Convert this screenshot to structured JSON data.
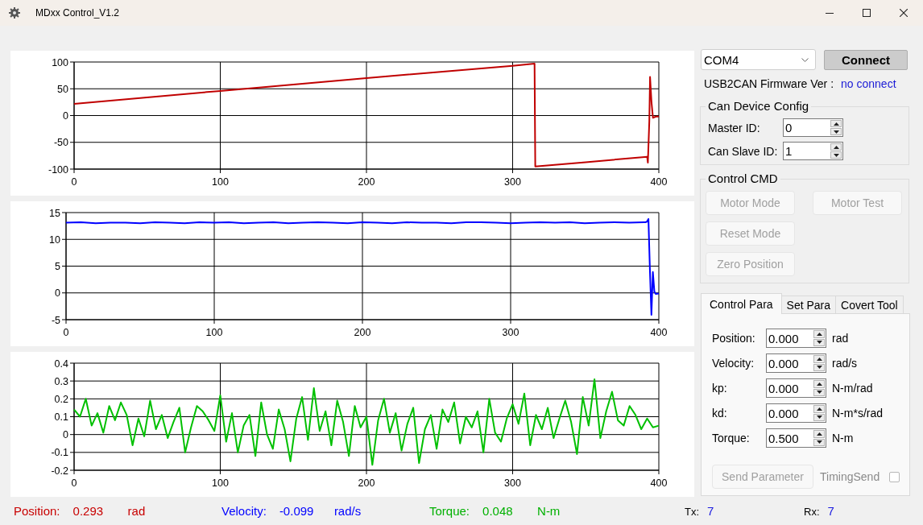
{
  "window": {
    "title": "MDxx Control_V1.2"
  },
  "charts": [
    {
      "chart_data": {
        "type": "line",
        "grid": true,
        "xlim": [
          0,
          400
        ],
        "ylim": [
          -100,
          100
        ],
        "xticks": [
          0,
          100,
          200,
          300,
          400
        ],
        "yticks": [
          100,
          50,
          0,
          -50,
          -100
        ],
        "x": [
          0,
          100,
          200,
          300,
          315,
          315.5,
          350,
          392,
          392.5,
          393.5,
          394,
          395,
          396,
          398,
          400
        ],
        "series": [
          {
            "color": "#c00000",
            "values": [
              22,
              46,
              70,
              93,
              97,
              -95,
              -87,
              -77,
              -88,
              -10,
              72,
              25,
              -4,
              -2,
              -2
            ]
          }
        ]
      }
    },
    {
      "chart_data": {
        "type": "line",
        "grid": true,
        "xlim": [
          0,
          400
        ],
        "ylim": [
          -5,
          15
        ],
        "xticks": [
          0,
          100,
          200,
          300,
          400
        ],
        "yticks": [
          15,
          10,
          5,
          0,
          -5
        ],
        "x": [
          0,
          10,
          20,
          30,
          40,
          50,
          60,
          70,
          80,
          90,
          100,
          110,
          120,
          130,
          140,
          150,
          160,
          170,
          180,
          190,
          200,
          210,
          220,
          230,
          240,
          250,
          260,
          270,
          280,
          290,
          300,
          310,
          320,
          330,
          340,
          350,
          360,
          370,
          380,
          390,
          391,
          392,
          393,
          394,
          395,
          396,
          397,
          398,
          400
        ],
        "series": [
          {
            "color": "#0000ff",
            "values": [
              13.1,
              13.2,
              13.0,
              13.1,
              13.1,
              13.0,
              13.2,
              13.1,
              13.0,
              13.2,
              13.1,
              13.2,
              13.0,
              13.1,
              13.2,
              13.0,
              13.1,
              13.2,
              13.1,
              13.0,
              13.2,
              13.1,
              13.0,
              13.2,
              13.1,
              13.1,
              13.0,
              13.2,
              13.2,
              13.1,
              13.0,
              13.1,
              13.2,
              13.1,
              13.2,
              13.0,
              13.1,
              13.2,
              13.1,
              13.2,
              13.2,
              13.3,
              13.8,
              4,
              -4.1,
              3.9,
              0.2,
              -0.2,
              -0.1
            ]
          }
        ]
      }
    },
    {
      "chart_data": {
        "type": "line",
        "grid": true,
        "xlim": [
          0,
          400
        ],
        "ylim": [
          -0.2,
          0.4
        ],
        "xticks": [
          0,
          100,
          200,
          300,
          400
        ],
        "yticks": [
          0.4,
          0.3,
          0.2,
          0.1,
          0,
          -0.1,
          -0.2
        ],
        "x": [
          0,
          4,
          8,
          12,
          16,
          20,
          24,
          28,
          32,
          36,
          40,
          44,
          48,
          52,
          56,
          60,
          64,
          68,
          72,
          76,
          80,
          84,
          88,
          92,
          96,
          100,
          104,
          108,
          112,
          116,
          120,
          124,
          128,
          132,
          136,
          140,
          144,
          148,
          152,
          156,
          160,
          164,
          168,
          172,
          176,
          180,
          184,
          188,
          192,
          196,
          200,
          204,
          208,
          212,
          216,
          220,
          224,
          228,
          232,
          236,
          240,
          244,
          248,
          252,
          256,
          260,
          264,
          268,
          272,
          276,
          280,
          284,
          288,
          292,
          296,
          300,
          304,
          308,
          312,
          316,
          320,
          324,
          328,
          332,
          336,
          340,
          344,
          348,
          352,
          356,
          360,
          364,
          368,
          372,
          376,
          380,
          384,
          388,
          392,
          396,
          400
        ],
        "series": [
          {
            "color": "#00c000",
            "values": [
              0.14,
              0.1,
              0.2,
              0.05,
              0.12,
              0.01,
              0.16,
              0.08,
              0.18,
              0.11,
              -0.06,
              0.09,
              -0.01,
              0.19,
              0.03,
              0.11,
              -0.02,
              0.07,
              0.15,
              -0.1,
              0.04,
              0.16,
              0.13,
              0.08,
              0.02,
              0.22,
              -0.04,
              0.12,
              -0.1,
              0.05,
              0.11,
              -0.12,
              0.18,
              0.0,
              -0.08,
              0.14,
              0.03,
              -0.15,
              0.09,
              0.21,
              -0.03,
              0.26,
              0.02,
              0.13,
              -0.06,
              0.19,
              0.07,
              -0.12,
              0.16,
              0.04,
              0.1,
              -0.17,
              0.08,
              0.2,
              0.01,
              0.12,
              -0.09,
              0.06,
              0.15,
              -0.16,
              0.03,
              0.11,
              -0.08,
              0.14,
              0.07,
              0.18,
              -0.05,
              0.1,
              0.04,
              0.13,
              -0.1,
              0.2,
              0.01,
              -0.04,
              0.09,
              0.17,
              0.06,
              0.23,
              -0.06,
              0.11,
              0.03,
              0.15,
              -0.02,
              0.09,
              0.19,
              0.07,
              -0.11,
              0.21,
              0.05,
              0.31,
              -0.02,
              0.13,
              0.24,
              0.08,
              0.05,
              0.16,
              0.11,
              0.03,
              0.09,
              0.04,
              0.05
            ]
          }
        ]
      }
    }
  ],
  "port_select": {
    "value": "COM4"
  },
  "connect_button": {
    "label": "Connect"
  },
  "firmware": {
    "label": "USB2CAN Firmware Ver :",
    "value": "no connect"
  },
  "device_config": {
    "title": "Can Device Config",
    "fields": [
      {
        "label": "Master ID:",
        "value": "0"
      },
      {
        "label": "Can Slave ID:",
        "value": "1"
      }
    ]
  },
  "control_cmd": {
    "title": "Control CMD",
    "buttons": [
      {
        "label": "Motor Mode",
        "disabled": true
      },
      {
        "label": "Motor Test",
        "disabled": true
      },
      {
        "label": "Reset Mode",
        "disabled": true
      },
      {
        "label": "Zero Position",
        "disabled": true
      }
    ]
  },
  "tabs": [
    {
      "label": "Control Para",
      "selected": true
    },
    {
      "label": "Set Para",
      "selected": false
    },
    {
      "label": "Covert Tool",
      "selected": false
    }
  ],
  "params": [
    {
      "label": "Position:",
      "value": "0.000",
      "unit": "rad"
    },
    {
      "label": "Velocity:",
      "value": "0.000",
      "unit": "rad/s"
    },
    {
      "label": "kp:",
      "value": "0.000",
      "unit": "N-m/rad"
    },
    {
      "label": "kd:",
      "value": "0.000",
      "unit": "N-m*s/rad"
    },
    {
      "label": "Torque:",
      "value": "0.500",
      "unit": "N-m"
    }
  ],
  "send_button": {
    "label": "Send Parameter",
    "disabled": true
  },
  "timing_send": {
    "label": "TimingSend",
    "checked": false,
    "disabled": true
  },
  "status_bar": {
    "readings": [
      {
        "label": "Position:",
        "value": "0.293",
        "unit": "rad",
        "color": "#c80000"
      },
      {
        "label": "Velocity:",
        "value": "-0.099",
        "unit": "rad/s",
        "color": "#0000ff"
      },
      {
        "label": "Torque:",
        "value": "0.048",
        "unit": "N-m",
        "color": "#00b000"
      }
    ],
    "counters": [
      {
        "label": "Tx:",
        "value": "7"
      },
      {
        "label": "Rx:",
        "value": "7"
      }
    ]
  }
}
